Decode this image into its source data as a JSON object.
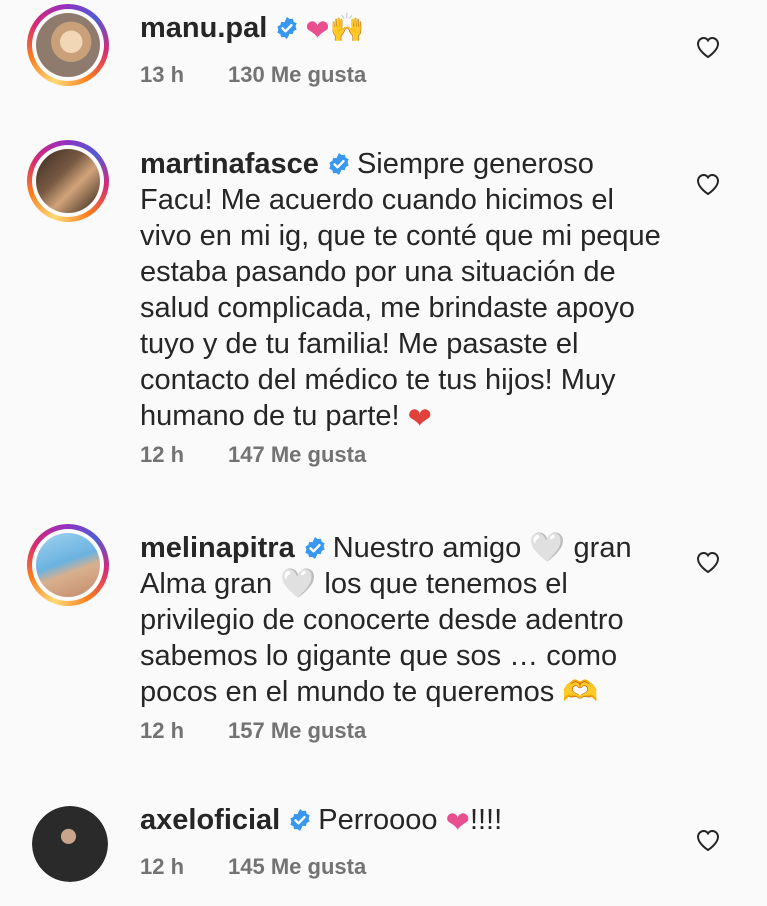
{
  "comments": [
    {
      "username": "manu.pal",
      "text": "",
      "emoji": "❤🙌",
      "time": "13 h",
      "likes": "130 Me gusta"
    },
    {
      "username": "martinafasce",
      "text": "Siempre generoso Facu! Me acuerdo cuando hicimos el vivo en mi ig, que te conté que mi peque estaba pasando por una situación de salud complicada, me brindaste apoyo tuyo y de tu familia! Me pasaste el contacto del médico te tus hijos! Muy humano de tu parte!",
      "emoji": "❤",
      "time": "12 h",
      "likes": "147 Me gusta"
    },
    {
      "username": "melinapitra",
      "text_parts": [
        "Nuestro amigo",
        "gran Alma gran",
        "los que tenemos el privilegio de conocerte desde adentro sabemos lo gigante  que sos … como pocos en el mundo te queremos"
      ],
      "emoji": "🤍",
      "time": "12 h",
      "likes": "157 Me gusta"
    },
    {
      "username": "axeloficial",
      "text_parts": [
        "Perroooo",
        "!!!!"
      ],
      "emoji": "❤",
      "time": "12 h",
      "likes": "145 Me gusta"
    }
  ],
  "icons": {
    "verified": "verified-badge-icon",
    "like": "heart-outline-icon"
  },
  "colors": {
    "verified_blue": "#3897f0",
    "pink_heart": "#e94e8f",
    "red_heart": "#e0413a",
    "meta_gray": "#737373"
  }
}
